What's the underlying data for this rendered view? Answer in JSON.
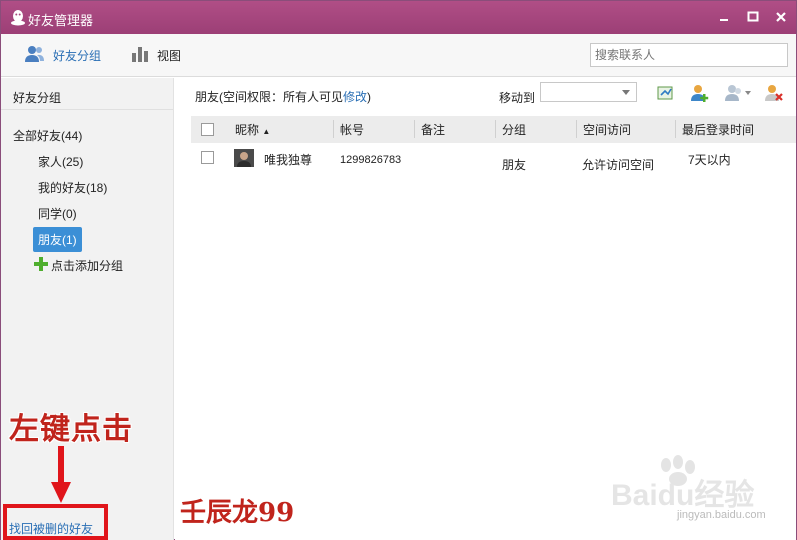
{
  "window": {
    "title": "好友管理器"
  },
  "toolbar": {
    "tabs": [
      {
        "label": "好友分组",
        "icon": "friends-icon",
        "active": true
      },
      {
        "label": "视图",
        "icon": "bar-chart-icon",
        "active": false
      }
    ],
    "search_placeholder": "搜索联系人"
  },
  "sidebar": {
    "header": "好友分组",
    "groups": [
      {
        "label": "全部好友(44)"
      },
      {
        "label": "家人(25)"
      },
      {
        "label": "我的好友(18)"
      },
      {
        "label": "同学(0)"
      },
      {
        "label": "朋友(1)",
        "selected": true
      }
    ],
    "add_group_label": "点击添加分组",
    "recover_link": "找回被删的好友"
  },
  "content": {
    "breadcrumb_prefix": "朋友(空间权限：所有人可见",
    "breadcrumb_link": "修改",
    "breadcrumb_suffix": ")",
    "move_to_label": "移动到",
    "actions": [
      "export-icon",
      "add-friend-icon",
      "group-icon",
      "delete-friend-icon"
    ],
    "columns": [
      "昵称",
      "帐号",
      "备注",
      "分组",
      "空间访问",
      "最后登录时间"
    ],
    "sort_indicator": "▲",
    "rows": [
      {
        "nickname": "唯我独尊",
        "account": "1299826783",
        "remark": "",
        "group": "朋友",
        "space_access": "允许访问空间",
        "last_login": "7天以内"
      }
    ]
  },
  "annotations": {
    "callout": "左键点击",
    "signature": "壬辰龙99",
    "watermark": "Baidu经验",
    "watermark_url": "jingyan.baidu.com"
  },
  "colors": {
    "titlebar": "#a6467e",
    "selected": "#3b8fd6",
    "link": "#2a6fb5",
    "annotation_red": "#c0241c"
  }
}
